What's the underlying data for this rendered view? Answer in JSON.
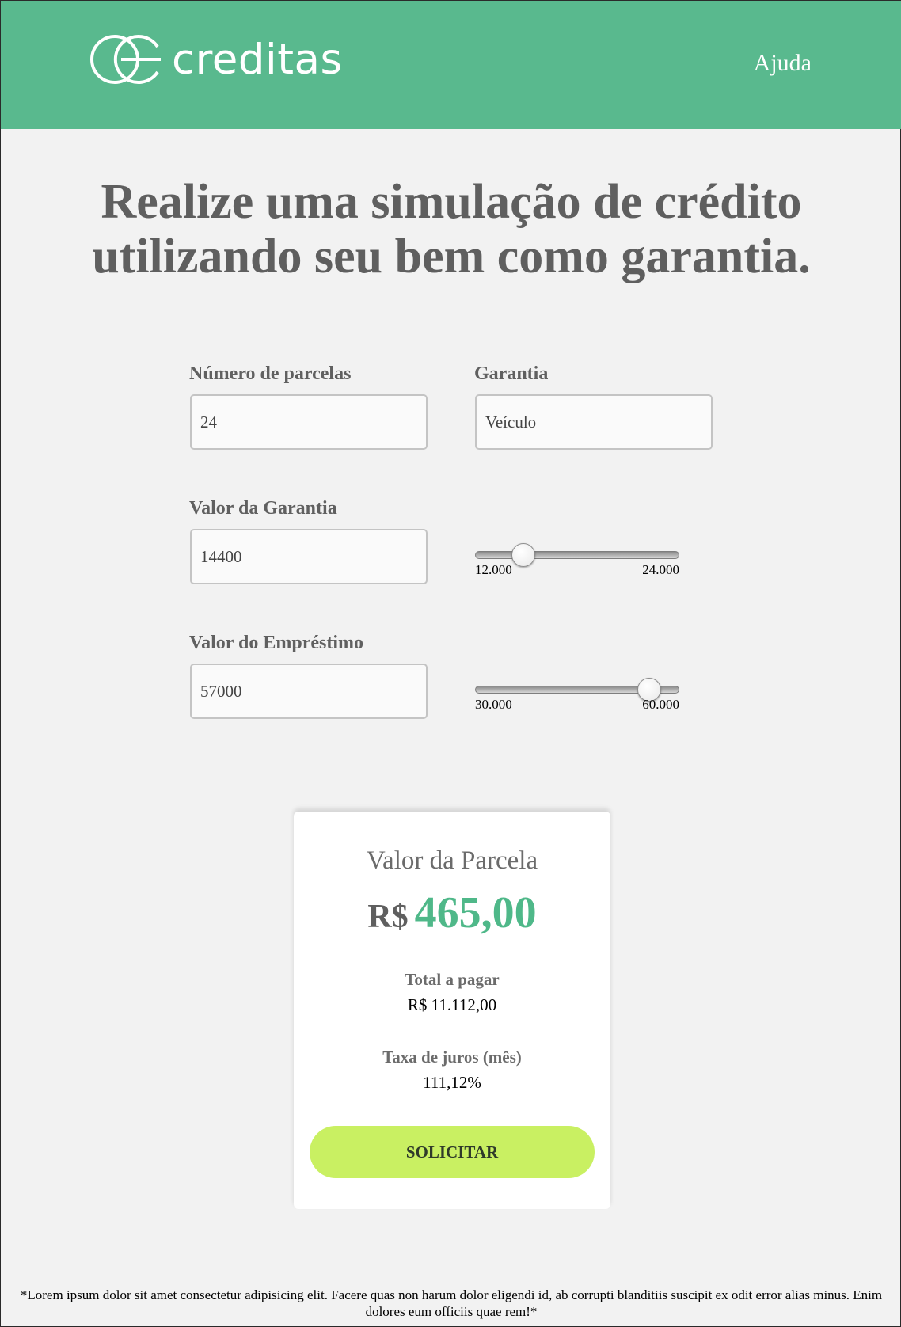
{
  "header": {
    "brand": "creditas",
    "help_link": "Ajuda",
    "background": "#59b98e",
    "logo_icon": "creditas-logo-icon"
  },
  "hero": {
    "title_line1": "Realize uma simulação de crédito",
    "title_line2": "utilizando seu bem como garantia."
  },
  "form": {
    "installments": {
      "label": "Número de parcelas",
      "value": "24"
    },
    "collateral": {
      "label": "Garantia",
      "value": "Veículo"
    },
    "collateral_value": {
      "label": "Valor da Garantia",
      "value": "14400",
      "slider": {
        "min_label": "12.000",
        "max_label": "24.000",
        "position_fraction": 0.2
      }
    },
    "loan_value": {
      "label": "Valor do Empréstimo",
      "value": "57000",
      "slider": {
        "min_label": "30.000",
        "max_label": "60.000",
        "position_fraction": 0.9
      }
    }
  },
  "result": {
    "title": "Valor da Parcela",
    "currency": "R$",
    "installment_amount": "465,00",
    "total_label": "Total a pagar",
    "total_value": "R$ 11.112,00",
    "rate_label": "Taxa de juros (mês)",
    "rate_value": "111,12%",
    "submit_label": "SOLICITAR",
    "accent_color": "#4fb889",
    "button_color": "#c9f062"
  },
  "footer": {
    "disclaimer": "*Lorem ipsum dolor sit amet consectetur adipisicing elit. Facere quas non harum dolor eligendi id, ab corrupti blanditiis suscipit ex odit error alias minus. Enim dolores eum officiis quae rem!*"
  }
}
